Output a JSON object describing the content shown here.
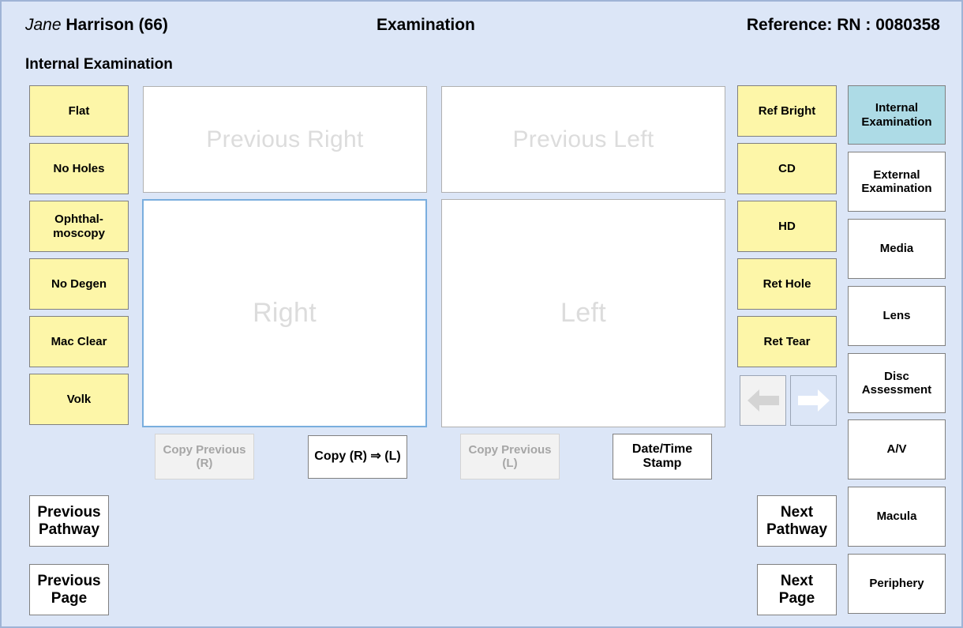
{
  "header": {
    "patient_given_name": "Jane",
    "patient_family_name": "Harrison (66)",
    "page_title": "Examination",
    "reference": "Reference: RN : 0080358",
    "section_title": "Internal Examination"
  },
  "findings_left": [
    {
      "label": "Flat"
    },
    {
      "label": "No Holes"
    },
    {
      "label": "Ophthal-\nmoscopy"
    },
    {
      "label": "No Degen"
    },
    {
      "label": "Mac Clear"
    },
    {
      "label": "Volk"
    }
  ],
  "findings_right": [
    {
      "label": "Ref Bright"
    },
    {
      "label": "CD"
    },
    {
      "label": "HD"
    },
    {
      "label": "Ret Hole"
    },
    {
      "label": "Ret Tear"
    }
  ],
  "panels": {
    "previous_right": "Previous Right",
    "previous_left": "Previous Left",
    "right": "Right",
    "left": "Left"
  },
  "actions": {
    "copy_previous_right": "Copy Previous\n(R)",
    "copy_right_to_left": "Copy (R) ⇒ (L)",
    "copy_previous_left": "Copy Previous\n(L)",
    "date_time_stamp": "Date/Time\nStamp"
  },
  "navigation": {
    "previous_pathway": "Previous\nPathway",
    "previous_page": "Previous\nPage",
    "next_pathway": "Next\nPathway",
    "next_page": "Next\nPage",
    "prev_arrow_icon": "arrow-left-icon",
    "next_arrow_icon": "arrow-right-icon"
  },
  "sidebar": {
    "items": [
      {
        "label": "Internal\nExamination",
        "selected": true
      },
      {
        "label": "External\nExamination",
        "selected": false
      },
      {
        "label": "Media",
        "selected": false
      },
      {
        "label": "Lens",
        "selected": false
      },
      {
        "label": "Disc\nAssessment",
        "selected": false
      },
      {
        "label": "A/V",
        "selected": false
      },
      {
        "label": "Macula",
        "selected": false
      },
      {
        "label": "Periphery",
        "selected": false
      }
    ]
  },
  "colors": {
    "page_background": "#dce6f7",
    "finding_button": "#fdf6a8",
    "selected_tab": "#addbe6",
    "focus_border": "#7aaede",
    "placeholder_text": "#dcdcdc"
  }
}
